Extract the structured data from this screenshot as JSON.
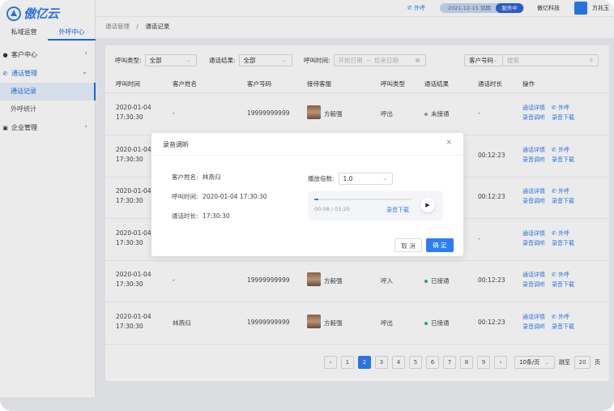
{
  "app": {
    "logo_text": "傲亿云",
    "top_tabs": [
      "私域运营",
      "外呼中心"
    ],
    "active_tab": 1
  },
  "sidebar": {
    "items": [
      {
        "label": "客户中心",
        "icon": "person-icon"
      },
      {
        "label": "通话管理",
        "icon": "phone-icon"
      },
      {
        "label": "企业管理",
        "icon": "building-icon"
      }
    ],
    "subitems": [
      "通话记录",
      "外呼统计"
    ]
  },
  "header": {
    "outbound": "外呼",
    "date_text": "2021-12-15 到期",
    "service_badge": "服务中",
    "company": "傲亿科技",
    "user": "方兆玉"
  },
  "breadcrumb": {
    "parent": "通话管理",
    "separator": "/",
    "current": "通话记录"
  },
  "filters": {
    "call_type_label": "呼叫类型:",
    "call_type_value": "全部",
    "result_label": "通话结果:",
    "result_value": "全部",
    "time_label": "呼叫时间:",
    "start_placeholder": "开始日期",
    "tilde": "~",
    "end_placeholder": "结束日期",
    "customer_select": "客户号码",
    "search_placeholder": "搜索"
  },
  "table": {
    "headers": [
      "呼叫时间",
      "客户姓名",
      "客户号码",
      "接待客服",
      "呼叫类型",
      "通话结果",
      "通话时长",
      "操作"
    ],
    "rows": [
      {
        "date": "2020-01-04",
        "time": "17:30:30",
        "name": "-",
        "phone": "19999999999",
        "agent": "方毅强",
        "type": "呼出",
        "result": "未接通",
        "result_color": "#9aa0a6",
        "duration": "-"
      },
      {
        "date": "2020-01-04",
        "time": "17:30:30",
        "name": "",
        "phone": "",
        "agent": "",
        "type": "",
        "result": "",
        "result_color": "#22b573",
        "duration": "00:12:23"
      },
      {
        "date": "2020-01-04",
        "time": "17:30:30",
        "name": "",
        "phone": "",
        "agent": "",
        "type": "",
        "result": "",
        "result_color": "#22b573",
        "duration": "00:12:23"
      },
      {
        "date": "2020-01-04",
        "time": "17:30:30",
        "name": "",
        "phone": "",
        "agent": "",
        "type": "",
        "result": "",
        "result_color": "#9aa0a6",
        "duration": "-"
      },
      {
        "date": "2020-01-04",
        "time": "17:30:30",
        "name": "-",
        "phone": "19999999999",
        "agent": "方毅强",
        "type": "呼入",
        "result": "已接通",
        "result_color": "#22b573",
        "duration": "00:12:23"
      },
      {
        "date": "2020-01-04",
        "time": "17:30:30",
        "name": "林燕归",
        "phone": "19999999999",
        "agent": "方毅强",
        "type": "呼出",
        "result": "已接通",
        "result_color": "#22b573",
        "duration": "00:12:23"
      }
    ],
    "ops": {
      "detail": "通话详情",
      "call": "外呼",
      "listen": "录音调听",
      "download": "录音下载"
    }
  },
  "pagination": {
    "pages": [
      "1",
      "2",
      "3",
      "4",
      "5",
      "6",
      "7",
      "8",
      "9"
    ],
    "current": "2",
    "page_size": "10条/页",
    "goto_label": "跳至",
    "goto_value": "20",
    "page_suffix": "页"
  },
  "modal": {
    "title": "录音调听",
    "name_label": "客户姓名:",
    "name_value": "林燕归",
    "time_label": "呼叫时间:",
    "time_value": "2020-01-04  17:30:30",
    "duration_label": "通话时长:",
    "duration_value": "17:30:30",
    "speed_label": "播放倍数:",
    "speed_value": "1.0",
    "progress_text": "00:08 / 03:20",
    "progress_fraction": 0.04,
    "download_label": "录音下载",
    "cancel": "取 消",
    "confirm": "确 定"
  }
}
